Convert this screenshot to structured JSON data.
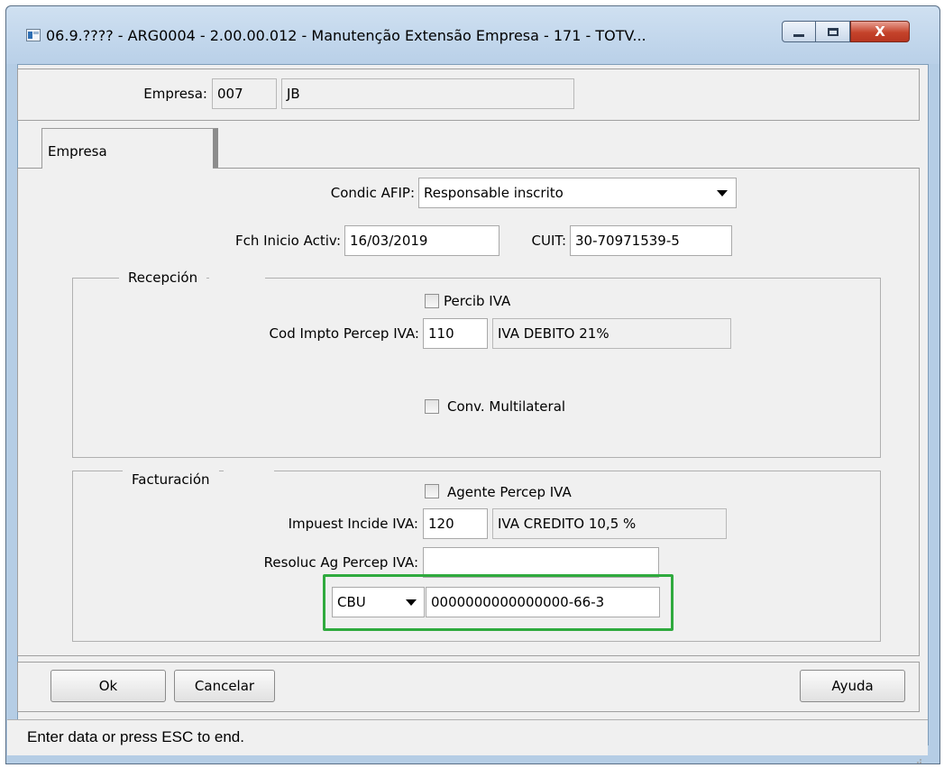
{
  "window": {
    "title": "06.9.???? - ARG0004 - 2.00.00.012 - Manutenção Extensão Empresa - 171 - TOTV...",
    "minimize_glyph": "—",
    "maximize_glyph": "□",
    "close_glyph": "X"
  },
  "header": {
    "empresa_label": "Empresa:",
    "empresa_code": "007",
    "empresa_name": "JB"
  },
  "tabs": [
    {
      "label": "Empresa",
      "active": true
    }
  ],
  "form": {
    "condic_afip_label": "Condic AFIP:",
    "condic_afip_value": "Responsable inscrito",
    "fch_inicio_label": "Fch Inicio Activ:",
    "fch_inicio_value": "16/03/2019",
    "cuit_label": "CUIT:",
    "cuit_value": "30-70971539-5"
  },
  "recepcion": {
    "title": "Recepción",
    "percib_iva_label": "Percib IVA",
    "percib_iva_checked": false,
    "cod_impto_label": "Cod Impto Percep IVA:",
    "cod_impto_value": "110",
    "cod_impto_desc": "IVA DEBITO 21%",
    "conv_multilateral_label": "Conv. Multilateral",
    "conv_multilateral_checked": false
  },
  "facturacion": {
    "title": "Facturación",
    "agente_percep_label": "Agente Percep IVA",
    "agente_percep_checked": false,
    "impuest_incide_label": "Impuest Incide IVA:",
    "impuest_incide_value": "120",
    "impuest_incide_desc": "IVA CREDITO 10,5 %",
    "resoluc_label": "Resoluc Ag Percep IVA:",
    "resoluc_value": "",
    "cbu_type": "CBU",
    "cbu_value": "0000000000000000-66-3"
  },
  "buttons": {
    "ok": "Ok",
    "cancel": "Cancelar",
    "help": "Ayuda"
  },
  "status": {
    "text": "Enter data or press ESC to end."
  },
  "colors": {
    "highlight": "#2faa3e",
    "window_frame": "#b5cde5"
  }
}
